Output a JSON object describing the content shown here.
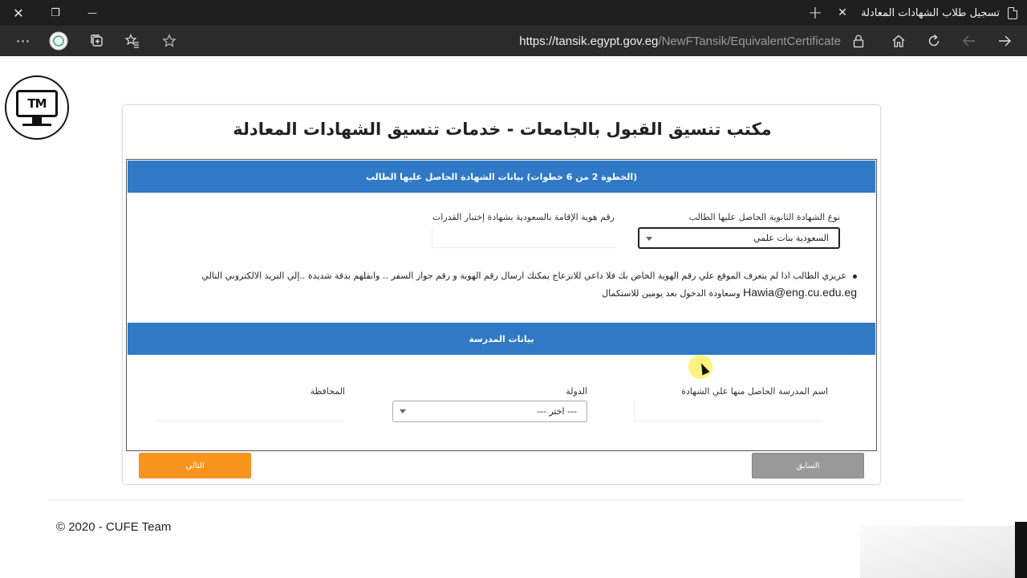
{
  "browser": {
    "tab_title": "تسجيل طلاب الشهادات المعادلة",
    "tab_close_icon": "close-icon",
    "new_tab_label": "+",
    "window_close_label": "✕",
    "window_restore_label": "❐",
    "window_minimize_label": "—",
    "url_host": "https://tansik.egypt.gov.eg",
    "url_path": "/NewFTansik/EquivalentCertificate",
    "icons": [
      "more-icon",
      "profile-icon",
      "collections-icon",
      "favorites-list-icon",
      "favorite-star-icon",
      "lock-icon",
      "home-icon",
      "refresh-icon",
      "back-icon",
      "forward-icon"
    ]
  },
  "logo": {
    "text": "TM"
  },
  "page": {
    "title": "مكتب تنسيق القبول بالجامعات - خدمات تنسيق الشهادات المعادلة",
    "step_header": "(الخطوة 2 من 6 خطوات) بيانات الشهادة الحاصل عليها الطالب",
    "certificate_type_label": "نوع الشهادة الثانوية الحاصل عليها الطالب",
    "certificate_type_value": "السعودية بنات علمي",
    "residence_id_label": "رقم هوية الإقامة بالسعودية بشهادة إختبار القدرات",
    "notice_text": "عزيزي الطالب اذا لم يتعرف الموقع علي رقم الهوية الخاص بك فلا داعي للانزعاج يمكنك ارسال رقم الهوية و رقم جواز السفر .. وانقلهم بدقة شديدة ..إلي البريد الالكتروني التالي",
    "notice_email": "Hawia@eng.cu.edu.eg",
    "notice_tail": "وسعاودة الدخول بعد يومين للاستكمال",
    "school_header": "بيانات المدرسة",
    "school_name_label": "اسم المدرسة الحاصل منها علي الشهادة",
    "country_label": "الدولة",
    "country_value": "--- اختر ---",
    "governorate_label": "المحافظة",
    "next_button": "التالي",
    "prev_button": "السابق",
    "footer": "© 2020 - CUFE Team"
  },
  "colors": {
    "header_blue": "#2f79c7",
    "next_orange": "#f7941d",
    "prev_gray": "#999999"
  }
}
